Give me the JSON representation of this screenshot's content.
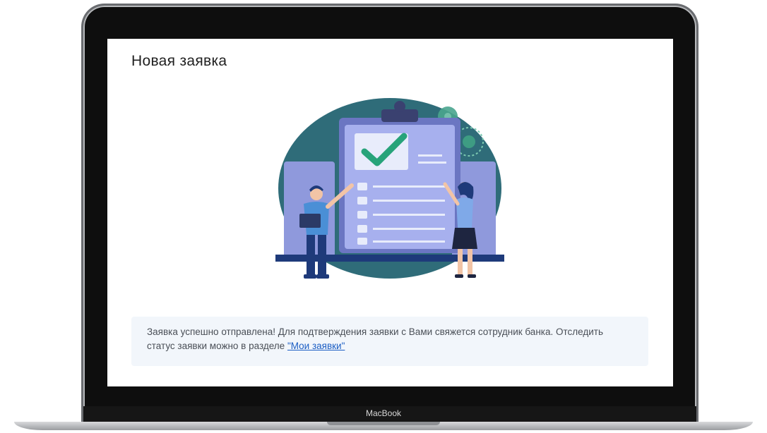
{
  "device": {
    "brand_label": "MacBook"
  },
  "page": {
    "title": "Новая заявка"
  },
  "illustration": {
    "icon": "clipboard-checkmark-illustration"
  },
  "notice": {
    "text": "Заявка успешно отправлена! Для подтверждения заявки с Вами свяжется сотрудник банка. Отследить статус заявки можно в разделе ",
    "link_label": "\"Мои заявки\""
  },
  "colors": {
    "teal": "#2f6c79",
    "clipboard": "#8f99dc",
    "clipboard_dark": "#6b76c2",
    "check": "#27a37a",
    "link": "#1c5ec4",
    "navy": "#1e3a7a"
  }
}
